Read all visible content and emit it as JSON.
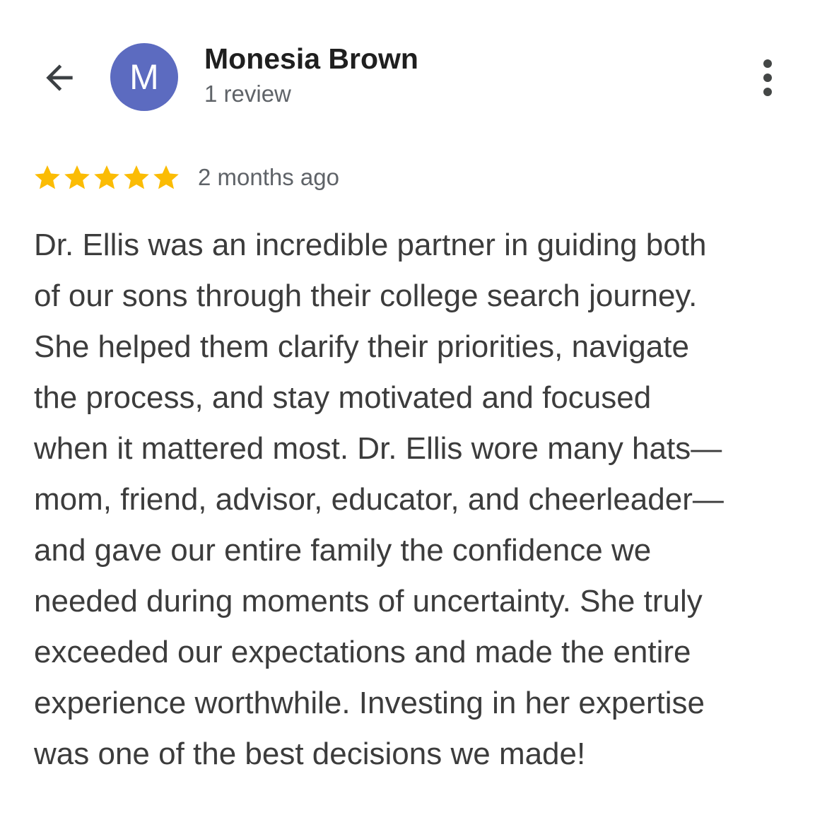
{
  "header": {
    "back_icon": "arrow-back-icon",
    "avatar_initial": "M",
    "avatar_color": "#5c6bc0",
    "reviewer_name": "Monesia Brown",
    "review_count": "1 review",
    "more_icon": "more-vert-icon"
  },
  "review": {
    "rating": 5,
    "rating_max": 5,
    "star_color": "#fbbc04",
    "date": "2 months ago",
    "text_lines": [
      "Dr. Ellis was an incredible partner in guiding both",
      "of our sons through their college search journey.",
      "She helped them clarify their priorities, navigate",
      "the process, and stay motivated and focused",
      "when it mattered most. Dr. Ellis wore many hats—",
      "mom, friend, advisor, educator, and cheerleader—",
      "and gave our entire family the confidence we",
      "needed during moments of uncertainty. She truly",
      "exceeded our expectations and made the entire",
      "experience worthwhile. Investing in her expertise",
      "was one of the best decisions we made!"
    ]
  }
}
